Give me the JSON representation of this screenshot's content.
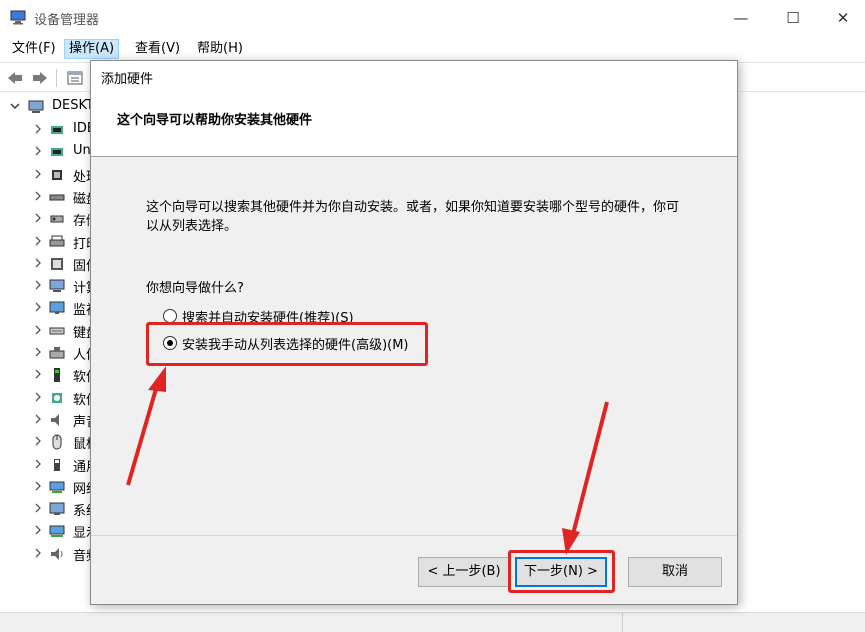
{
  "window": {
    "title": "设备管理器",
    "minimize_glyph": "—",
    "maximize_glyph": "☐",
    "close_glyph": "✕"
  },
  "menu": {
    "file": "文件(F)",
    "action": "操作(A)",
    "view": "查看(V)",
    "help": "帮助(H)"
  },
  "tree": {
    "root": "DESKTOP",
    "items": [
      {
        "label": "IDE",
        "icon": "ide-controller-icon"
      },
      {
        "label": "Un",
        "icon": "usb-controller-icon"
      },
      {
        "label": "处理",
        "icon": "processor-icon"
      },
      {
        "label": "磁盘",
        "icon": "disk-drive-icon"
      },
      {
        "label": "存储",
        "icon": "storage-controller-icon"
      },
      {
        "label": "打印",
        "icon": "printer-icon"
      },
      {
        "label": "固件",
        "icon": "firmware-icon"
      },
      {
        "label": "计算",
        "icon": "computer-icon"
      },
      {
        "label": "监视",
        "icon": "monitor-icon"
      },
      {
        "label": "键盘",
        "icon": "keyboard-icon"
      },
      {
        "label": "人体",
        "icon": "hid-icon"
      },
      {
        "label": "软件",
        "icon": "software-component-icon"
      },
      {
        "label": "软件",
        "icon": "software-device-icon"
      },
      {
        "label": "声音",
        "icon": "audio-icon"
      },
      {
        "label": "鼠标",
        "icon": "mouse-icon"
      },
      {
        "label": "通用",
        "icon": "usb-icon"
      },
      {
        "label": "网络",
        "icon": "network-adapter-icon"
      },
      {
        "label": "系统",
        "icon": "system-device-icon"
      },
      {
        "label": "显示",
        "icon": "display-adapter-icon"
      },
      {
        "label": "音频",
        "icon": "audio-io-icon"
      }
    ]
  },
  "dialog": {
    "title": "添加硬件",
    "header_title": "这个向导可以帮助你安装其他硬件",
    "description": "这个向导可以搜索其他硬件并为你自动安装。或者，如果你知道要安装哪个型号的硬件，你可以从列表选择。",
    "question": "你想向导做什么?",
    "option_auto": "搜索并自动安装硬件(推荐)(S)",
    "option_manual": "安装我手动从列表选择的硬件(高级)(M)",
    "selected_option": "manual",
    "back_button": "< 上一步(B)",
    "next_button": "下一步(N) >",
    "cancel_button": "取消"
  },
  "annotations": {
    "highlight_color": "#e02424"
  }
}
